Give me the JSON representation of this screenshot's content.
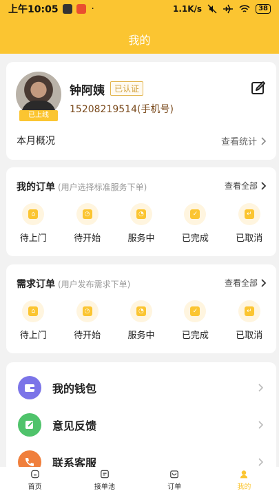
{
  "status_bar": {
    "time": "上午10:05",
    "network_speed": "1.1K/s",
    "battery": "38"
  },
  "header": {
    "title": "我的"
  },
  "profile": {
    "name": "钟阿姨",
    "certified_label": "已认证",
    "phone": "15208219514(手机号)",
    "online_badge": "已上线",
    "month_overview": "本月概况",
    "view_stats": "查看统计"
  },
  "my_orders": {
    "title": "我的订单",
    "note": "(用户选择标准服务下单)",
    "view_all": "查看全部",
    "items": [
      {
        "label": "待上门",
        "icon": "doorstep-icon"
      },
      {
        "label": "待开始",
        "icon": "start-icon"
      },
      {
        "label": "服务中",
        "icon": "in-service-icon"
      },
      {
        "label": "已完成",
        "icon": "completed-icon"
      },
      {
        "label": "已取消",
        "icon": "cancelled-icon"
      }
    ]
  },
  "demand_orders": {
    "title": "需求订单",
    "note": "(用户发布需求下单)",
    "view_all": "查看全部",
    "items": [
      {
        "label": "待上门",
        "icon": "doorstep-icon"
      },
      {
        "label": "待开始",
        "icon": "start-icon"
      },
      {
        "label": "服务中",
        "icon": "in-service-icon"
      },
      {
        "label": "已完成",
        "icon": "completed-icon"
      },
      {
        "label": "已取消",
        "icon": "cancelled-icon"
      }
    ]
  },
  "menu": [
    {
      "label": "我的钱包",
      "icon": "wallet-icon",
      "color": "#7b74e8"
    },
    {
      "label": "意见反馈",
      "icon": "feedback-icon",
      "color": "#4fc36b"
    },
    {
      "label": "联系客服",
      "icon": "phone-icon",
      "color": "#f07f3c"
    }
  ],
  "tabs": [
    {
      "label": "首页",
      "icon": "home-icon"
    },
    {
      "label": "接单池",
      "icon": "order-pool-icon"
    },
    {
      "label": "订单",
      "icon": "orders-icon"
    },
    {
      "label": "我的",
      "icon": "profile-icon",
      "active": true
    }
  ],
  "colors": {
    "accent": "#fbc531",
    "cert": "#d3a23f",
    "phone": "#7a4a1c"
  }
}
